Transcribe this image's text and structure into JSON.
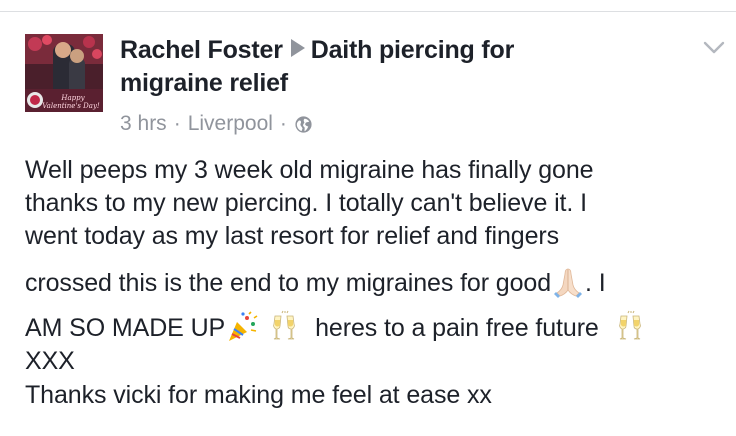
{
  "post": {
    "author": "Rachel Foster",
    "group": "Daith piercing for migraine relief",
    "group_line1": "Daith piercing for",
    "group_line2": "migraine relief",
    "time": "3 hrs",
    "separator": "·",
    "location": "Liverpool",
    "privacy_icon": "globe-icon",
    "menu_icon": "chevron-down-icon",
    "avatar_caption": "Happy Valentine's Day!",
    "body": {
      "line1": "Well peeps my 3 week old migraine has finally gone",
      "line2": "thanks to my new piercing. I totally can't believe it. I",
      "line3": "went today as my last resort for relief and fingers",
      "line4_text": "crossed this is the end to my migraines for good",
      "line4_tail": ". I",
      "line5_text": "AM SO MADE UP",
      "line5_middle": "heres to a pain free future",
      "line6": "XXX",
      "line7": "Thanks vicki for making me feel at ease xx",
      "emojis": [
        "folded-hands-emoji",
        "party-popper-emoji",
        "clinking-glasses-emoji",
        "clinking-glasses-emoji"
      ]
    }
  },
  "colors": {
    "text": "#1d2129",
    "meta": "#90949c",
    "border": "#dddfe2"
  }
}
